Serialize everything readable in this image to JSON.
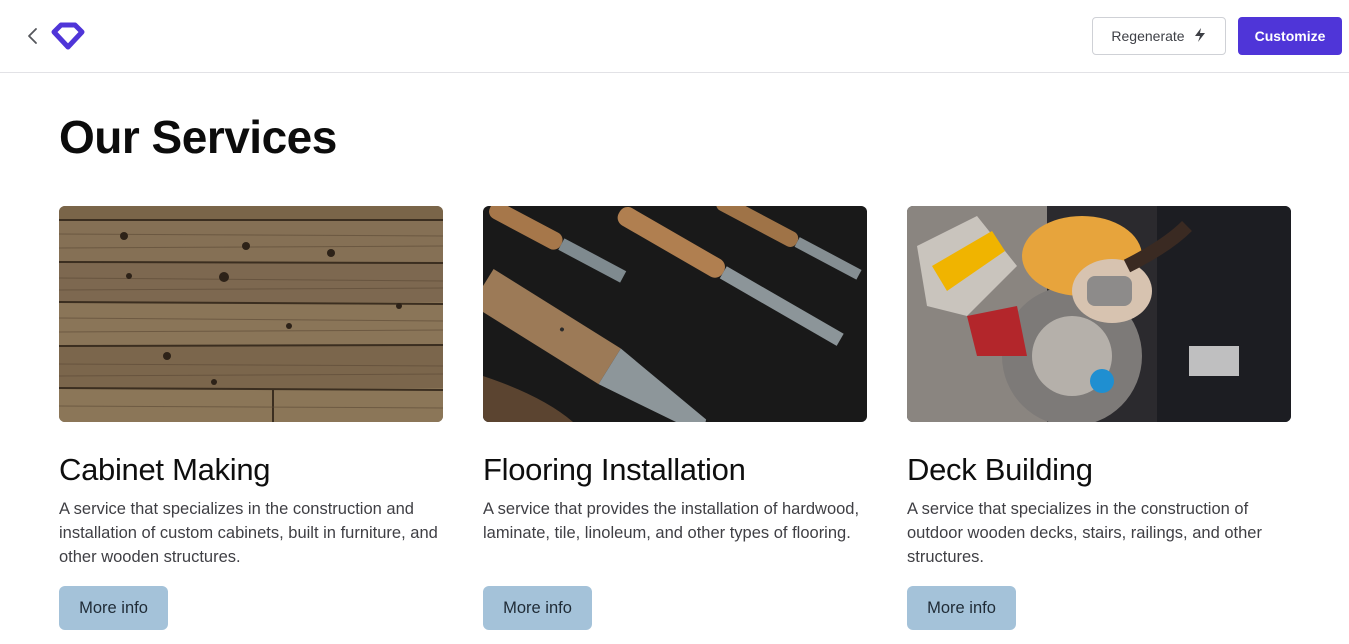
{
  "header": {
    "regenerate_label": "Regenerate",
    "customize_label": "Customize",
    "icons": [
      "chevron-left-icon",
      "diamond-logo-icon",
      "lightning-icon"
    ],
    "accent_color": "#4f35d8"
  },
  "main": {
    "title": "Our Services",
    "services": [
      {
        "title": "Cabinet Making",
        "description": "A service that specializes in the construction and installation of custom cabinets, built in furniture, and other wooden structures.",
        "button_label": "More info",
        "image": "weathered wooden planks"
      },
      {
        "title": "Flooring Installation",
        "description": "A service that provides the installation of hardwood, laminate, tile, linoleum, and other types of flooring.",
        "button_label": "More info",
        "image": "wood carving chisels on black cloth"
      },
      {
        "title": "Deck Building",
        "description": "A service that specializes in the construction of outdoor wooden decks, stairs, railings, and other structures.",
        "button_label": "More info",
        "image": "man in hard hat using DEWALT miter saw"
      }
    ]
  },
  "colors": {
    "button_bg": "#a4c2d9",
    "primary": "#4f35d8"
  }
}
